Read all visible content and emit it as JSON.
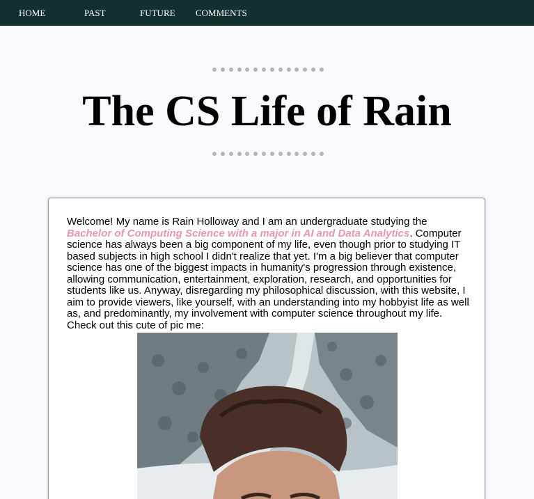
{
  "nav": {
    "items": [
      {
        "label": "HOME"
      },
      {
        "label": "PAST"
      },
      {
        "label": "FUTURE"
      },
      {
        "label": "COMMENTS"
      }
    ]
  },
  "header": {
    "title": "The CS Life of Rain"
  },
  "intro": {
    "before_link": "Welcome! My name is Rain Holloway and I am an undergraduate studying the ",
    "link_text": "Bachelor of Computing Science with a major in AI and Data Analytics",
    "after_link": ". Computer science has always been a big component of my life, even though prior to studying IT based subjects in high school I didn't realize that yet. I'm a big believer that computer science has one of the biggest impacts in humanity's progression through existence, allowing communication, entertainment, exploration, research, and opportunities for students like us. Anyway, disregarding my philosophical discussion, with this website, I aim to provide viewers, like yourself, with an understanding into my hobbyist life as well as, and predominantly, my involvement with computer science throughout my life. Check out this cute of pic me:"
  },
  "colors": {
    "navbar": "#12302e",
    "link": "#e895b4",
    "dots": "#b4b4bc",
    "page_background": "#f8f8fd"
  },
  "photo": {
    "icon": "profile-photo"
  }
}
